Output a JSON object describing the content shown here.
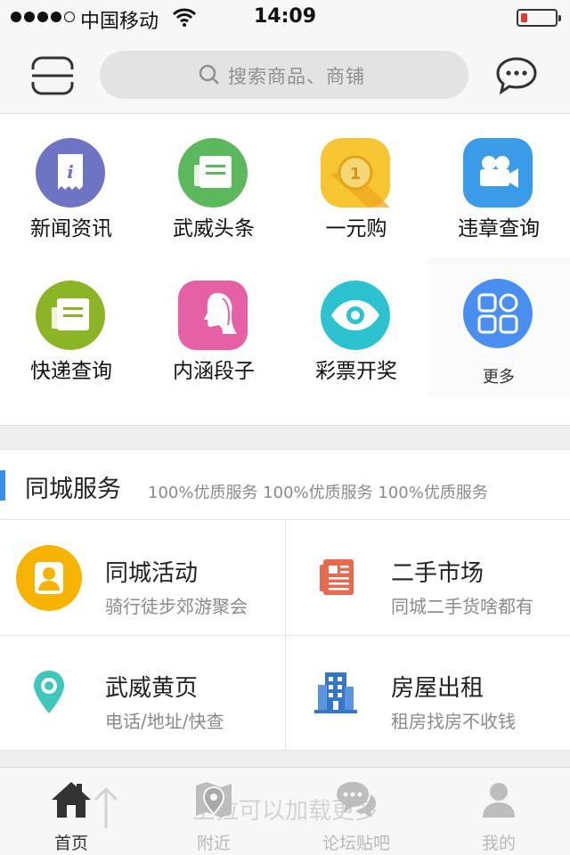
{
  "status_bar": {
    "carrier": "中国移动",
    "time": "14:09",
    "battery_level": 0.15
  },
  "header": {
    "search_placeholder": "搜索商品、商铺"
  },
  "grid_items": [
    {
      "label": "新闻资讯",
      "icon": "news-icon",
      "color": "#6e73c4"
    },
    {
      "label": "武威头条",
      "icon": "headline-icon",
      "color": "#5cb85c"
    },
    {
      "label": "一元购",
      "icon": "coin-icon",
      "color": "#f7c531"
    },
    {
      "label": "违章查询",
      "icon": "camera-icon",
      "color": "#3a9be8"
    },
    {
      "label": "快递查询",
      "icon": "express-icon",
      "color": "#8bb526"
    },
    {
      "label": "内涵段子",
      "icon": "profile-icon",
      "color": "#e560a4"
    },
    {
      "label": "彩票开奖",
      "icon": "eye-icon",
      "color": "#2dc2cf"
    },
    {
      "label": "更多",
      "icon": "more-grid-icon",
      "color": "#3e8ef0"
    }
  ],
  "section": {
    "title": "同城服务",
    "subtitle": "100%优质服务 100%优质服务 100%优质服务"
  },
  "services": [
    {
      "title": "同城活动",
      "subtitle": "骑行徒步郊游聚会",
      "icon": "person-icon",
      "color": "#f6b400"
    },
    {
      "title": "二手市场",
      "subtitle": "同城二手货啥都有",
      "icon": "newspaper-icon",
      "color": "#e9694f"
    },
    {
      "title": "武威黄页",
      "subtitle": "电话/地址/快查",
      "icon": "location-pin-icon",
      "color": "#3fc7bb"
    },
    {
      "title": "房屋出租",
      "subtitle": "租房找房不收钱",
      "icon": "building-icon",
      "color": "#3676c9"
    }
  ],
  "pull_hint": "上拉可以加载更多",
  "tabs": [
    {
      "label": "首页",
      "icon": "home-icon",
      "active": true
    },
    {
      "label": "附近",
      "icon": "nearby-icon",
      "active": false
    },
    {
      "label": "论坛贴吧",
      "icon": "forum-icon",
      "active": false
    },
    {
      "label": "我的",
      "icon": "user-icon",
      "active": false
    }
  ]
}
